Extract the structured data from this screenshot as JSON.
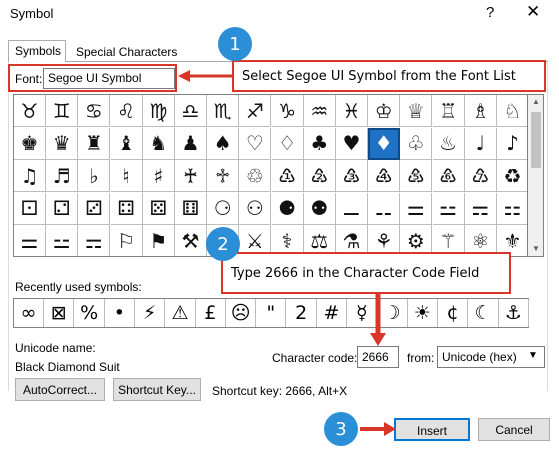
{
  "window": {
    "title": "Symbol",
    "help": "?",
    "close": "✕"
  },
  "tabs": [
    {
      "label": "Symbols"
    },
    {
      "label": "Special Characters"
    }
  ],
  "font": {
    "label": "Font:",
    "value": "Segoe UI Symbol"
  },
  "grid": {
    "cols": 16,
    "rows": [
      [
        "♉",
        "♊",
        "♋",
        "♌",
        "♍",
        "♎",
        "♏",
        "♐",
        "♑",
        "♒",
        "♓",
        "♔",
        "♕",
        "♖",
        "♗",
        "♘"
      ],
      [
        "♚",
        "♛",
        "♜",
        "♝",
        "♞",
        "♟",
        "♠",
        "♡",
        "♢",
        "♣",
        "♥",
        "♦",
        "♧",
        "♨",
        "♩",
        "♪"
      ],
      [
        "♫",
        "♬",
        "♭",
        "♮",
        "♯",
        "♰",
        "♱",
        "♲",
        "♳",
        "♴",
        "♵",
        "♶",
        "♷",
        "♸",
        "♹",
        "♻"
      ],
      [
        "⚀",
        "⚁",
        "⚂",
        "⚃",
        "⚄",
        "⚅",
        "⚆",
        "⚇",
        "⚈",
        "⚉",
        "⚊",
        "⚋",
        "⚌",
        "⚍",
        "⚎",
        "⚏"
      ],
      [
        "⚌",
        "⚍",
        "⚎",
        "⚐",
        "⚑",
        "⚒",
        "⚓",
        "⚔",
        "⚕",
        "⚖",
        "⚗",
        "⚘",
        "⚙",
        "⚚",
        "⚛",
        "⚜"
      ]
    ],
    "selected": {
      "row": 1,
      "col": 11
    }
  },
  "recent": {
    "label": "Recently used symbols:",
    "symbols": [
      "∞",
      "⊠",
      "%",
      "•",
      "⚡",
      "⚠",
      "£",
      "☹",
      "\"",
      "2",
      "#",
      "☿",
      "☽",
      "☀",
      "¢",
      "☾",
      "⚓"
    ]
  },
  "unicode_name": {
    "label": "Unicode name:",
    "value": "Black Diamond Suit"
  },
  "character_code": {
    "label": "Character code:",
    "value": "2666"
  },
  "from": {
    "label": "from:",
    "value": "Unicode (hex)"
  },
  "buttons": {
    "autocorrect": "AutoCorrect...",
    "shortcut_key": "Shortcut Key...",
    "insert": "Insert",
    "cancel": "Cancel"
  },
  "shortcut_text": "Shortcut key: 2666, Alt+X",
  "callouts": {
    "step1_badge": "1",
    "step1_text": "Select Segoe UI Symbol from the Font List",
    "step2_badge": "2",
    "step2_text": "Type 2666 in the Character Code Field",
    "step3_badge": "3"
  },
  "colors": {
    "annotation": "#d9352a",
    "badge": "#2a8fd6",
    "selection": "#1f72c6"
  }
}
